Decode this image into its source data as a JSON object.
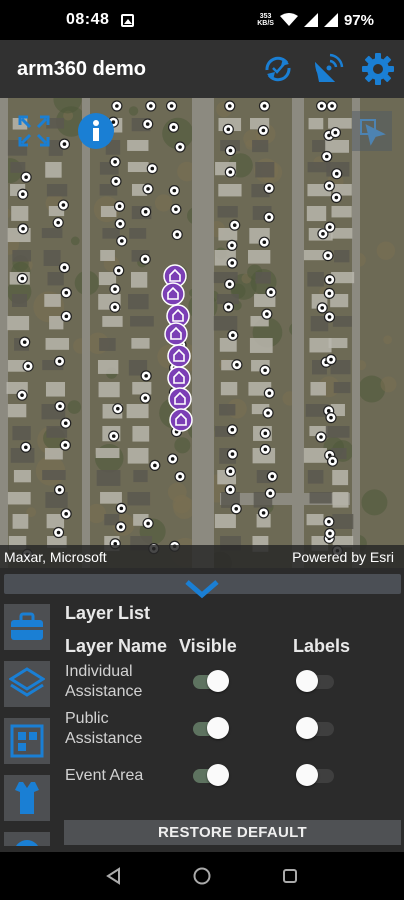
{
  "status_bar": {
    "time": "08:48",
    "net_speed_value": "353",
    "net_speed_unit": "KB/S",
    "battery": "97%"
  },
  "app_bar": {
    "title": "arm360 demo",
    "actions": [
      "sync-icon",
      "satellite-dish-icon",
      "gear-icon"
    ],
    "accent_color": "#1a7fd4"
  },
  "map": {
    "attribution_left": "Maxar, Microsoft",
    "attribution_right": "Powered by Esri",
    "marker_color": "#7b3fb5"
  },
  "layer_panel": {
    "title": "Layer List",
    "columns": {
      "name": "Layer Name",
      "visible": "Visible",
      "labels": "Labels"
    },
    "layers": [
      {
        "name": "Individual Assistance",
        "visible": true,
        "labels": false
      },
      {
        "name": "Public Assistance",
        "visible": true,
        "labels": false
      },
      {
        "name": "Event Area",
        "visible": true,
        "labels": false
      }
    ],
    "restore_button": "RESTORE DEFAULT",
    "side_tabs": [
      "toolbox-icon",
      "layers-icon",
      "portrait-icon",
      "shirt-icon",
      "globe-icon"
    ]
  }
}
